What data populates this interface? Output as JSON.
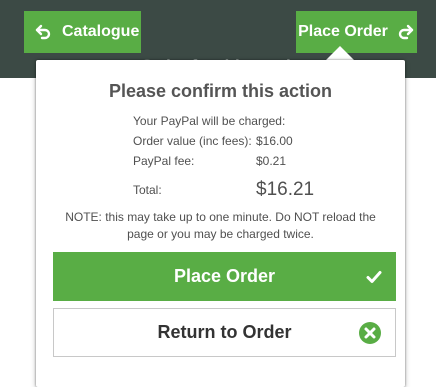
{
  "header": {
    "back_label": "Catalogue",
    "place_order_label": "Place Order",
    "title_behind": "Order for this week"
  },
  "icons": {
    "back": "back-arrow-icon",
    "place_order": "forward-arrow-icon",
    "confirm": "checkmark-icon",
    "cancel": "close-circle-icon"
  },
  "dialog": {
    "title": "Please confirm this action",
    "intro": "Your PayPal will be charged:",
    "order_value_label": "Order value (inc fees):",
    "order_value": "$16.00",
    "paypal_fee_label": "PayPal fee:",
    "paypal_fee": "$0.21",
    "total_label": "Total:",
    "total": "$16.21",
    "note": "NOTE: this may take up to one minute. Do NOT reload the page or you may be charged twice.",
    "place_order_label": "Place Order",
    "return_label": "Return to Order"
  },
  "colors": {
    "header_bg": "#3c4a45",
    "accent_green": "#59ad45",
    "text": "#505050",
    "cancel_icon": "#59ad45"
  }
}
